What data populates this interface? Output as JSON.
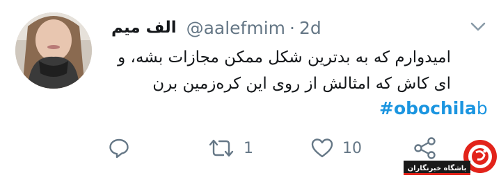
{
  "tweet": {
    "display_name": "الف میم",
    "handle": "@aalefmim",
    "separator": "·",
    "time": "2d",
    "text_lines": [
      "امیدوارم که به بدترین شکل ممکن مجازات بشه، و",
      "ای کاش که امثالش از روی این کره‌زمین برن"
    ],
    "hashtag_link": "#obochila",
    "hashtag_rest": "b"
  },
  "actions": {
    "reply_icon": "reply-icon",
    "retweet_icon": "retweet-icon",
    "retweet_count": "1",
    "like_icon": "heart-icon",
    "like_count": "10",
    "share_icon": "share-icon"
  },
  "watermark": {
    "text": "باشگاه خبرنگاران"
  },
  "colors": {
    "link": "#1b95e0",
    "secondary": "#657786",
    "primary_text": "#14171a",
    "watermark_red": "#e2231a"
  }
}
